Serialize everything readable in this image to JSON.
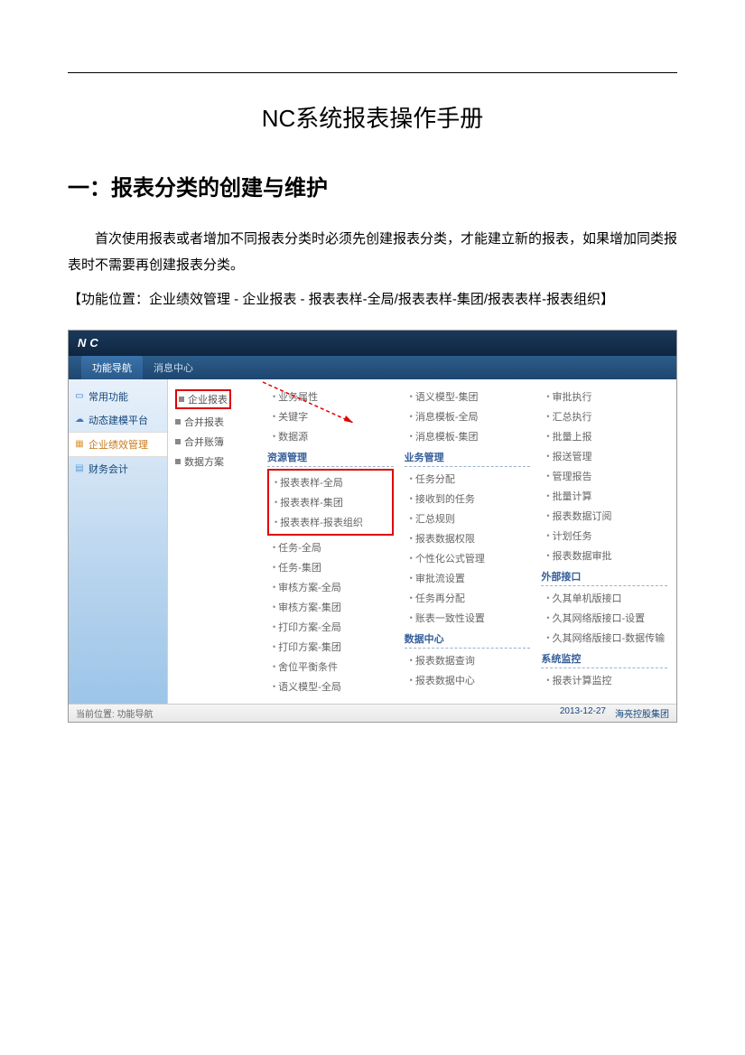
{
  "doc": {
    "title": "NC系统报表操作手册",
    "section": "一：报表分类的创建与维护",
    "para1": "首次使用报表或者增加不同报表分类时必须先创建报表分类，才能建立新的报表，如果增加同类报表时不需要再创建报表分类。",
    "location": "【功能位置：企业绩效管理 - 企业报表 - 报表表样-全局/报表表样-集团/报表表样-报表组织】"
  },
  "app": {
    "logo": "NC",
    "tabs": {
      "t1": "功能导航",
      "t2": "消息中心"
    },
    "sidebar": {
      "s1": "常用功能",
      "s2": "动态建模平台",
      "s3": "企业绩效管理",
      "s4": "财务会计"
    },
    "tree": {
      "n1": "企业报表",
      "n2": "合并报表",
      "n3": "合并账簿",
      "n4": "数据方案"
    },
    "col1": {
      "i1": "业务属性",
      "i2": "关键字",
      "i3": "数据源",
      "h1": "资源管理",
      "r1": "报表表样-全局",
      "r2": "报表表样-集团",
      "r3": "报表表样-报表组织",
      "i4": "任务-全局",
      "i5": "任务-集团",
      "i6": "审核方案-全局",
      "i7": "审核方案-集团",
      "i8": "打印方案-全局",
      "i9": "打印方案-集团",
      "i10": "舍位平衡条件",
      "i11": "语义模型-全局"
    },
    "col2": {
      "i1": "语义模型-集团",
      "i2": "消息模板-全局",
      "i3": "消息模板-集团",
      "h1": "业务管理",
      "i4": "任务分配",
      "i5": "接收到的任务",
      "i6": "汇总规则",
      "i7": "报表数据权限",
      "i8": "个性化公式管理",
      "i9": "审批流设置",
      "i10": "任务再分配",
      "i11": "账表一致性设置",
      "h2": "数据中心",
      "i12": "报表数据查询",
      "i13": "报表数据中心"
    },
    "col3": {
      "i1": "审批执行",
      "i2": "汇总执行",
      "i3": "批量上报",
      "i4": "报送管理",
      "i5": "管理报告",
      "i6": "批量计算",
      "i7": "报表数据订阅",
      "i8": "计划任务",
      "i9": "报表数据审批",
      "h1": "外部接口",
      "i10": "久其单机版接口",
      "i11": "久其网络版接口-设置",
      "i12": "久其网络版接口-数据传输",
      "h2": "系统监控",
      "i13": "报表计算监控"
    },
    "status": {
      "left": "当前位置: 功能导航",
      "date": "2013-12-27",
      "org": "海亮控股集团"
    }
  }
}
